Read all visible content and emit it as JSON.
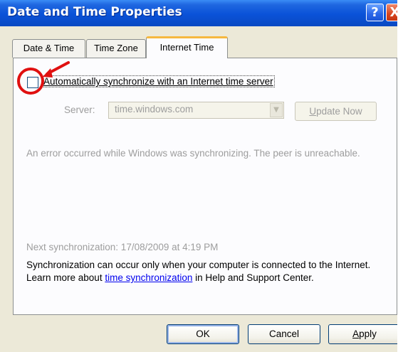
{
  "window": {
    "title": "Date and Time Properties",
    "help_glyph": "?",
    "close_glyph": "X"
  },
  "tabs": [
    {
      "label": "Date & Time",
      "selected": false
    },
    {
      "label": "Time Zone",
      "selected": false
    },
    {
      "label": "Internet Time",
      "selected": true
    }
  ],
  "internet_time": {
    "auto_sync": {
      "checked": false,
      "label_first": "A",
      "label_rest": "utomatically synchronize with an Internet time server"
    },
    "server": {
      "label": "Server:",
      "value": "time.windows.com",
      "dropdown_glyph": "▼"
    },
    "update_button": {
      "mnemonic": "U",
      "label_rest": "pdate Now"
    },
    "error_message": "An error occurred while Windows was synchronizing.  The peer is unreachable.",
    "next_sync": "Next synchronization: 17/08/2009 at 4:19 PM",
    "note": {
      "before_link": "Synchronization can occur only when your computer is connected to the Internet.  Learn more about ",
      "link": "time synchronization",
      "after_link": " in Help and Support Center."
    }
  },
  "buttons": {
    "ok": "OK",
    "cancel": "Cancel",
    "apply_mnemonic": "A",
    "apply_rest": "pply"
  },
  "annotation": {
    "color": "#e01010"
  },
  "colors": {
    "titlebar": "#0a52d8",
    "dialog_bg": "#ece9d8",
    "active_tab_accent": "#f6b83f",
    "disabled_text": "#9d9d9d"
  }
}
